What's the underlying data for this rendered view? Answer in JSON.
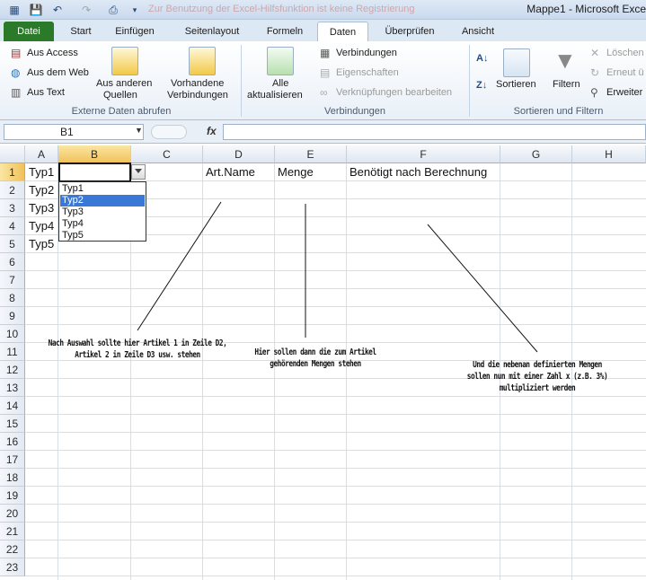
{
  "window": {
    "title": "Mappe1 - Microsoft Exce",
    "faded_title": "Zur Benutzung der Excel-Hilfsfunktion ist keine Registrierung"
  },
  "tabs": [
    "Datei",
    "Start",
    "Einfügen",
    "Seitenlayout",
    "Formeln",
    "Daten",
    "Überprüfen",
    "Ansicht"
  ],
  "ribbon": {
    "aus_access": "Aus Access",
    "aus_web": "Aus dem Web",
    "aus_text": "Aus Text",
    "aus_anderen_1": "Aus anderen",
    "aus_anderen_2": "Quellen",
    "vorhandene_1": "Vorhandene",
    "vorhandene_2": "Verbindungen",
    "alle_1": "Alle",
    "alle_2": "aktualisieren",
    "verbindungen": "Verbindungen",
    "eigenschaften": "Eigenschaften",
    "verknuepfungen": "Verknüpfungen bearbeiten",
    "sortieren": "Sortieren",
    "filtern": "Filtern",
    "loeschen": "Löschen",
    "erneut": "Erneut ü",
    "erweitert": "Erweiter",
    "grp_extern": "Externe Daten abrufen",
    "grp_verbindungen": "Verbindungen",
    "grp_sort": "Sortieren und Filtern"
  },
  "formula": {
    "namebox": "B1",
    "fx": "fx",
    "value": ""
  },
  "columns": [
    "A",
    "B",
    "C",
    "D",
    "E",
    "F",
    "G",
    "H"
  ],
  "rows": [
    "1",
    "2",
    "3",
    "4",
    "5",
    "6",
    "7",
    "8",
    "9",
    "10",
    "11",
    "12",
    "13",
    "14",
    "15",
    "16",
    "17",
    "18",
    "19",
    "20",
    "21",
    "22",
    "23"
  ],
  "cells": {
    "A1": "Typ1",
    "A2": "Typ2",
    "A3": "Typ3",
    "A4": "Typ4",
    "A5": "Typ5",
    "D1": "Art.Name",
    "E1": "Menge",
    "F1": "Benötigt nach Berechnung"
  },
  "dropdown": {
    "items": [
      "Typ1",
      "Typ2",
      "Typ3",
      "Typ4",
      "Typ5"
    ],
    "highlighted": "Typ2"
  },
  "notes": {
    "left": [
      "Nach Auswahl sollte hier Artikel 1 in Zeile D2,",
      "Artikel 2 in Zeile D3 usw. stehen"
    ],
    "middle": [
      "Hier sollen dann die zum Artikel",
      "gehörenden Mengen stehen"
    ],
    "right": [
      "Und die nebenan definierten Mengen",
      "sollen nun mit einer Zahl x (z.B. 3%)",
      "multipliziert werden"
    ]
  }
}
